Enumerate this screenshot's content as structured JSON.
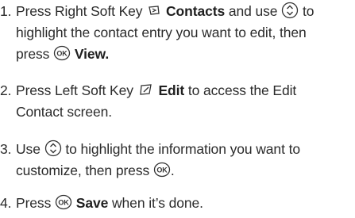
{
  "steps": [
    {
      "num": "1.",
      "l1_a": "Press Right Soft Key",
      "l1_bold": "Contacts",
      "l1_b": "and use",
      "l1_c": "to",
      "l2": "highlight the contact entry you want to edit, then",
      "l3_a": "press",
      "l3_bold": "View."
    },
    {
      "num": "2.",
      "l1_a": "Press Left Soft Key",
      "l1_bold": "Edit",
      "l1_b": "to access the Edit",
      "l2": "Contact screen."
    },
    {
      "num": "3.",
      "l1_a": "Use",
      "l1_b": "to highlight the information you want to",
      "l2_a": "customize, then press",
      "l2_end": "."
    },
    {
      "num": "4.",
      "l1_a": "Press",
      "l1_bold": "Save",
      "l1_b": "when it’s done."
    }
  ],
  "icons": {
    "right_soft_key": "right-soft-key-icon",
    "left_soft_key": "left-soft-key-icon",
    "nav_key": "navigation-key-icon",
    "ok_key": "ok-key-icon"
  }
}
